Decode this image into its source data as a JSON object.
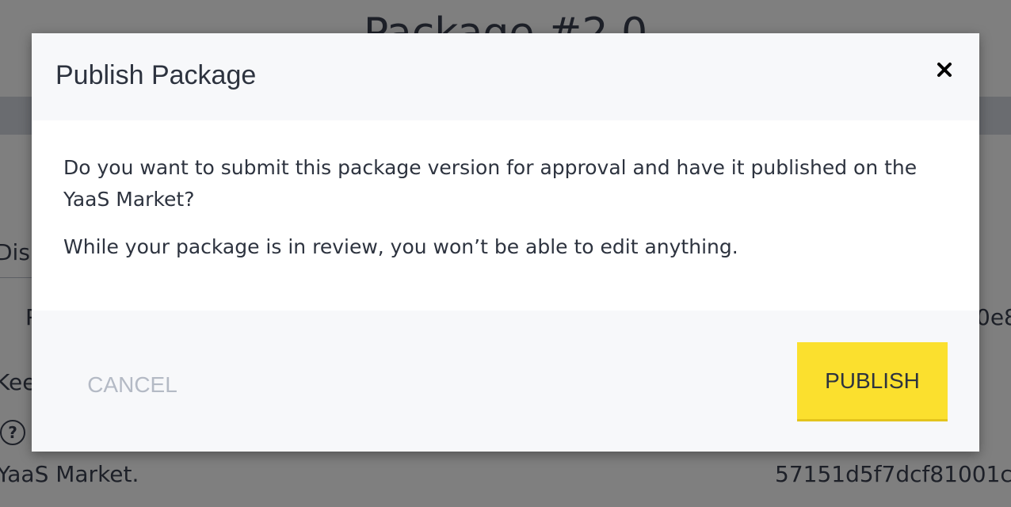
{
  "background": {
    "page_title": "Package #2.0",
    "field_fragment": "Disp",
    "row_fragment_left": "P",
    "row_fragment_right": "0e8",
    "input_fragment": "Kee",
    "help_icon": "?",
    "market_text": "YaaS Market.",
    "hash_text": "57151d5f7dcf81001c"
  },
  "modal": {
    "title": "Publish Package",
    "close_icon": "close-x-icon",
    "body": {
      "question": "Do you want to submit this package version for approval and have it published on the YaaS Market?",
      "notice": "While your package is in review, you won’t be able to edit anything."
    },
    "footer": {
      "cancel_label": "CANCEL",
      "publish_label": "PUBLISH"
    },
    "colors": {
      "publish_accent": "#fbe02e",
      "header_footer_bg": "#f7f8fa",
      "overlay": "rgba(0,0,0,0.5)"
    }
  }
}
